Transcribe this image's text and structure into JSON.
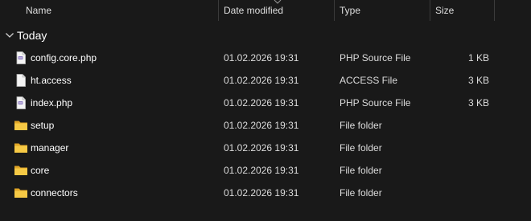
{
  "columns": {
    "name": "Name",
    "date": "Date modified",
    "type": "Type",
    "size": "Size"
  },
  "group": {
    "title": "Today"
  },
  "files": [
    {
      "name": "config.core.php",
      "date": "01.02.2026 19:31",
      "type": "PHP Source File",
      "size": "1 KB",
      "icon": "php-file-icon"
    },
    {
      "name": "ht.access",
      "date": "01.02.2026 19:31",
      "type": "ACCESS File",
      "size": "3 KB",
      "icon": "blank-file-icon"
    },
    {
      "name": "index.php",
      "date": "01.02.2026 19:31",
      "type": "PHP Source File",
      "size": "3 KB",
      "icon": "php-file-icon"
    },
    {
      "name": "setup",
      "date": "01.02.2026 19:31",
      "type": "File folder",
      "size": "",
      "icon": "folder-icon"
    },
    {
      "name": "manager",
      "date": "01.02.2026 19:31",
      "type": "File folder",
      "size": "",
      "icon": "folder-icon"
    },
    {
      "name": "core",
      "date": "01.02.2026 19:31",
      "type": "File folder",
      "size": "",
      "icon": "folder-icon"
    },
    {
      "name": "connectors",
      "date": "01.02.2026 19:31",
      "type": "File folder",
      "size": "",
      "icon": "folder-icon"
    }
  ],
  "colors": {
    "background": "#191919",
    "folder": "#f2c94c",
    "php_badge": "#8e7cc3"
  }
}
